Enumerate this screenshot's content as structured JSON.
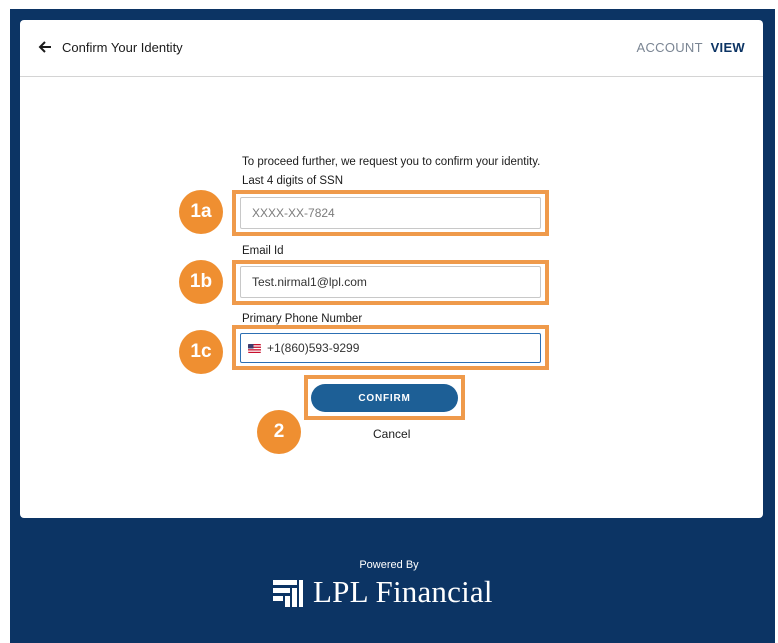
{
  "header": {
    "title": "Confirm Your Identity",
    "account_label": "ACCOUNT",
    "view_label": "VIEW"
  },
  "form": {
    "intro": "To proceed further, we request you to confirm your identity.",
    "ssn": {
      "label": "Last 4 digits of SSN",
      "placeholder": "XXXX-XX-7824"
    },
    "email": {
      "label": "Email Id",
      "value": "Test.nirmal1@lpl.com"
    },
    "phone": {
      "label": "Primary Phone Number",
      "value": "+1(860)593-9299",
      "country_icon": "us-flag-icon"
    },
    "confirm_label": "CONFIRM",
    "cancel_label": "Cancel"
  },
  "callouts": [
    "1a",
    "1b",
    "1c",
    "2"
  ],
  "footer": {
    "powered_by": "Powered By",
    "brand": "LPL Financial"
  },
  "colors": {
    "frame": "#0c3464",
    "highlight": "#ef9a4b",
    "badge": "#ef8f31",
    "button": "#1d5f96"
  }
}
